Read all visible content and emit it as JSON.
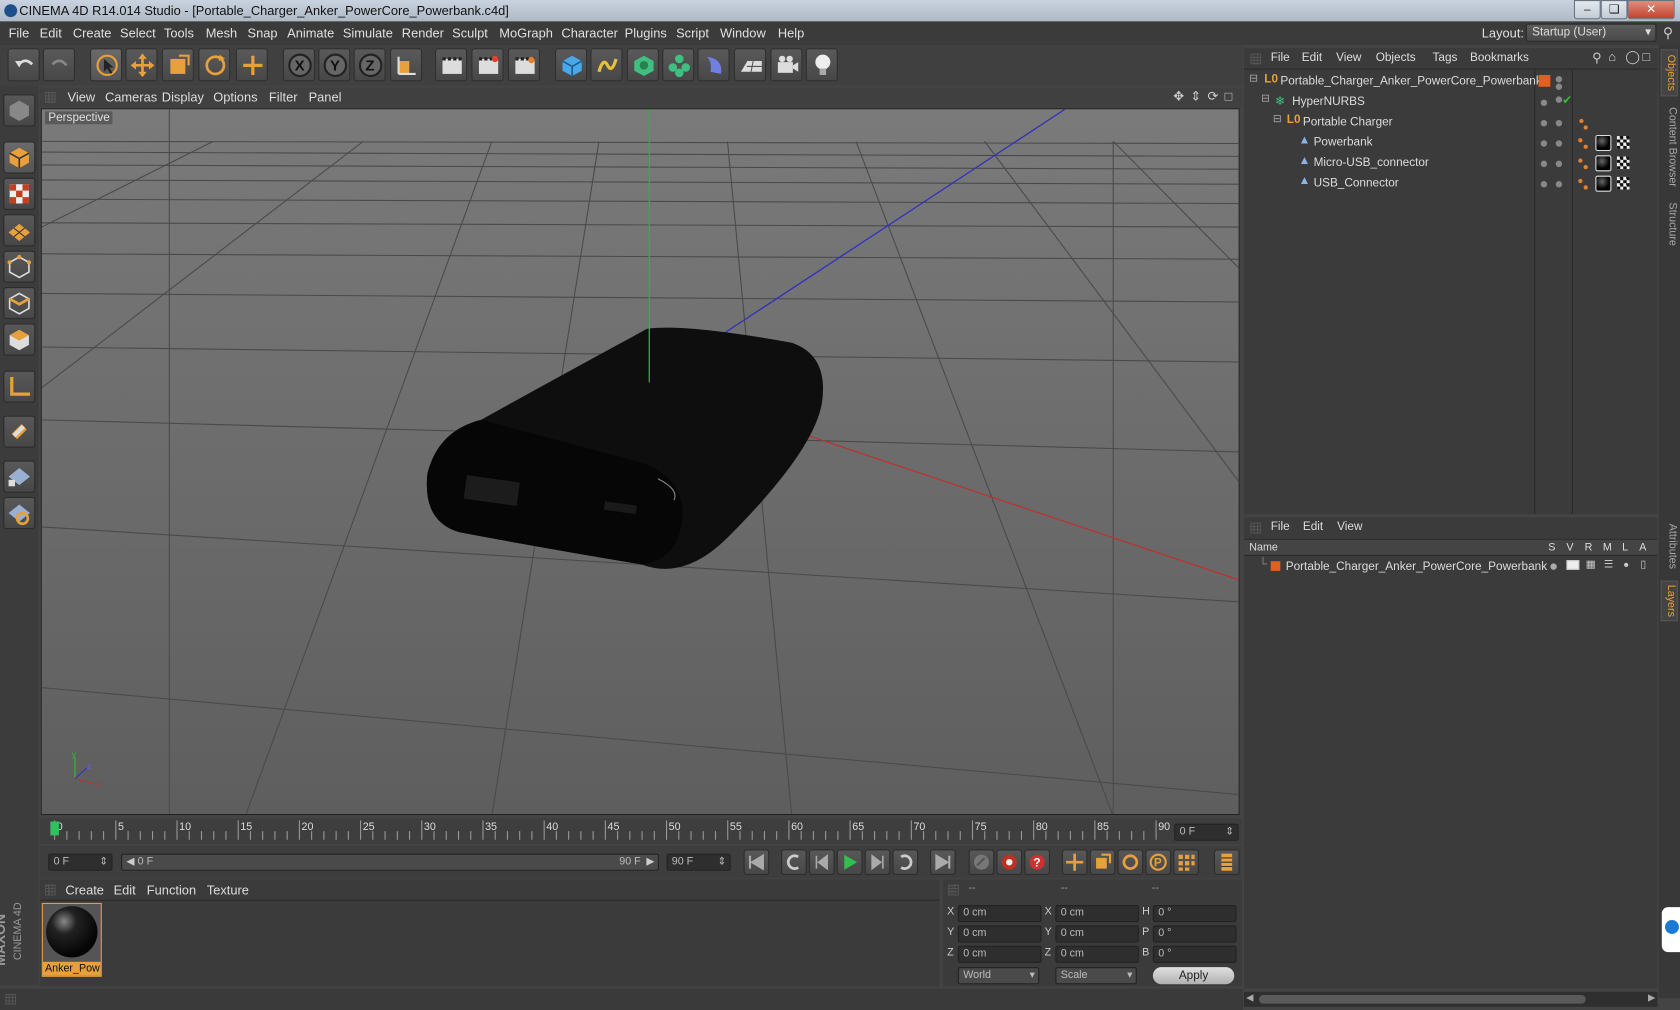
{
  "window": {
    "title": "CINEMA 4D R14.014 Studio - [Portable_Charger_Anker_PowerCore_Powerbank.c4d]"
  },
  "menu": [
    "File",
    "Edit",
    "Create",
    "Select",
    "Tools",
    "Mesh",
    "Snap",
    "Animate",
    "Simulate",
    "Render",
    "Sculpt",
    "MoGraph",
    "Character",
    "Plugins",
    "Script",
    "Window",
    "Help"
  ],
  "layout": {
    "label": "Layout:",
    "value": "Startup (User)"
  },
  "viewport": {
    "menu": [
      "View",
      "Cameras",
      "Display",
      "Options",
      "Filter",
      "Panel"
    ],
    "camera_label": "Perspective"
  },
  "object_manager": {
    "menu": [
      "File",
      "Edit",
      "View",
      "Objects",
      "Tags",
      "Bookmarks"
    ],
    "items": [
      {
        "label": "Portable_Charger_Anker_PowerCore_Powerbank",
        "depth": 0,
        "type": "null"
      },
      {
        "label": "HyperNURBS",
        "depth": 1,
        "type": "nurbs"
      },
      {
        "label": "Portable Charger",
        "depth": 2,
        "type": "null"
      },
      {
        "label": "Powerbank",
        "depth": 3,
        "type": "poly"
      },
      {
        "label": "Micro-USB_connector",
        "depth": 3,
        "type": "poly"
      },
      {
        "label": "USB_Connector",
        "depth": 3,
        "type": "poly"
      }
    ]
  },
  "layer_manager": {
    "menu": [
      "File",
      "Edit",
      "View"
    ],
    "name_header": "Name",
    "flag_headers": [
      "S",
      "V",
      "R",
      "M",
      "L",
      "A"
    ],
    "items": [
      {
        "label": "Portable_Charger_Anker_PowerCore_Powerbank"
      }
    ]
  },
  "side_tabs": [
    "Objects",
    "Content Browser",
    "Structure",
    "Attributes",
    "Layers"
  ],
  "timeline": {
    "ticks": [
      "0",
      "5",
      "10",
      "15",
      "20",
      "25",
      "30",
      "35",
      "40",
      "45",
      "50",
      "55",
      "60",
      "65",
      "70",
      "75",
      "80",
      "85",
      "90"
    ],
    "current_frame": "0 F"
  },
  "transport": {
    "start_field": "0 F",
    "range_start": "0 F",
    "range_end": "90 F",
    "end_field": "90 F"
  },
  "material_manager": {
    "menu": [
      "Create",
      "Edit",
      "Function",
      "Texture"
    ],
    "materials": [
      {
        "label": "Anker_Pow"
      }
    ]
  },
  "coordinates": {
    "headers": [
      "--",
      "--",
      "--"
    ],
    "rows": [
      {
        "a": "X",
        "a_val": "0 cm",
        "b": "X",
        "b_val": "0 cm",
        "c": "H",
        "c_val": "0 °"
      },
      {
        "a": "Y",
        "a_val": "0 cm",
        "b": "Y",
        "b_val": "0 cm",
        "c": "P",
        "c_val": "0 °"
      },
      {
        "a": "Z",
        "a_val": "0 cm",
        "b": "Z",
        "b_val": "0 cm",
        "c": "B",
        "c_val": "0 °"
      }
    ],
    "mode": "World",
    "size_mode": "Scale",
    "apply": "Apply"
  },
  "branding": {
    "maxon": "MAXON",
    "cinema": "CINEMA 4D"
  },
  "colors": {
    "accent": "#e8a03c",
    "viewport_bg": "#6a6a6a",
    "panel_bg": "#3b3b3b",
    "x_axis": "#c03030",
    "y_axis": "#30c030",
    "z_axis": "#3030c0"
  }
}
